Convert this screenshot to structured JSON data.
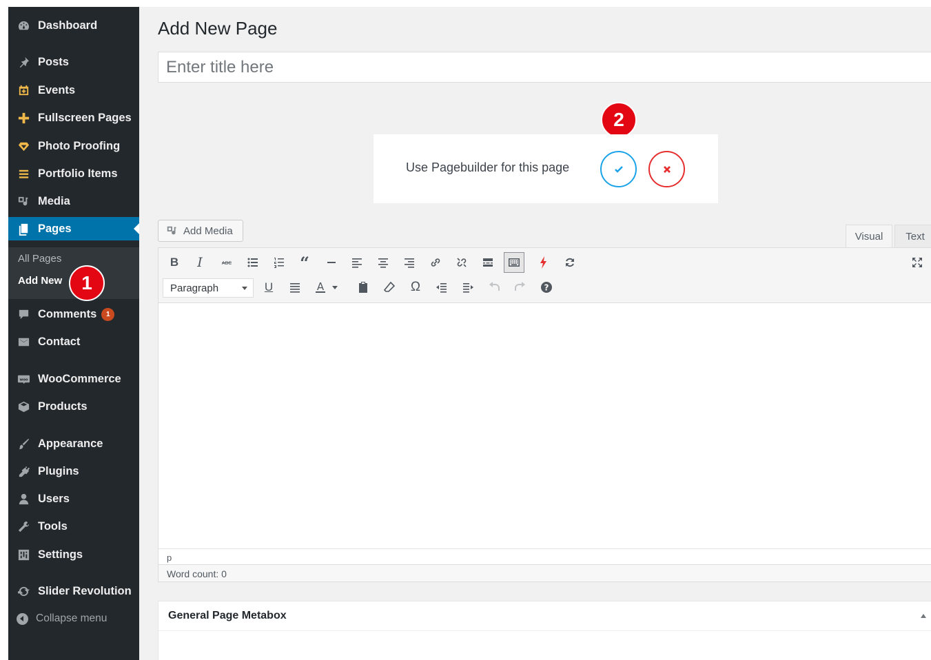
{
  "sidebar": {
    "items": [
      {
        "id": "dashboard",
        "label": "Dashboard",
        "icon": "dashboard-icon"
      },
      {
        "id": "posts",
        "label": "Posts",
        "icon": "pin-icon"
      },
      {
        "id": "events",
        "label": "Events",
        "icon": "calendar-icon"
      },
      {
        "id": "fullscreen-pages",
        "label": "Fullscreen Pages",
        "icon": "plus-icon"
      },
      {
        "id": "photo-proofing",
        "label": "Photo Proofing",
        "icon": "diamond-icon"
      },
      {
        "id": "portfolio-items",
        "label": "Portfolio Items",
        "icon": "list-icon"
      },
      {
        "id": "media",
        "label": "Media",
        "icon": "media-icon"
      },
      {
        "id": "pages",
        "label": "Pages",
        "icon": "pages-icon"
      },
      {
        "id": "comments",
        "label": "Comments",
        "icon": "comment-icon",
        "badge": "1"
      },
      {
        "id": "contact",
        "label": "Contact",
        "icon": "envelope-icon"
      },
      {
        "id": "woocommerce",
        "label": "WooCommerce",
        "icon": "woo-icon"
      },
      {
        "id": "products",
        "label": "Products",
        "icon": "box-icon"
      },
      {
        "id": "appearance",
        "label": "Appearance",
        "icon": "brush-icon"
      },
      {
        "id": "plugins",
        "label": "Plugins",
        "icon": "plug-icon"
      },
      {
        "id": "users",
        "label": "Users",
        "icon": "user-icon"
      },
      {
        "id": "tools",
        "label": "Tools",
        "icon": "wrench-icon"
      },
      {
        "id": "settings",
        "label": "Settings",
        "icon": "sliders-icon"
      },
      {
        "id": "slider-revolution",
        "label": "Slider Revolution",
        "icon": "refresh-icon"
      }
    ],
    "submenu": [
      {
        "label": "All Pages"
      },
      {
        "label": "Add New"
      }
    ],
    "collapse_label": "Collapse menu"
  },
  "markers": {
    "one": "1",
    "two": "2"
  },
  "main": {
    "title": "Add New Page",
    "title_placeholder": "Enter title here",
    "pagebuilder_prompt": "Use Pagebuilder for this page",
    "add_media_label": "Add Media",
    "tabs": {
      "visual": "Visual",
      "text": "Text"
    },
    "format_select": "Paragraph",
    "path": "p",
    "word_count": "Word count: 0",
    "metabox_title": "General Page Metabox"
  },
  "colors": {
    "sidebar_bg": "#23282d",
    "accent": "#0073aa",
    "marker_red": "#e30613",
    "confirm_blue": "#1aa3e8",
    "cancel_red": "#e62e2e",
    "badge_orange": "#ca4a1f"
  }
}
